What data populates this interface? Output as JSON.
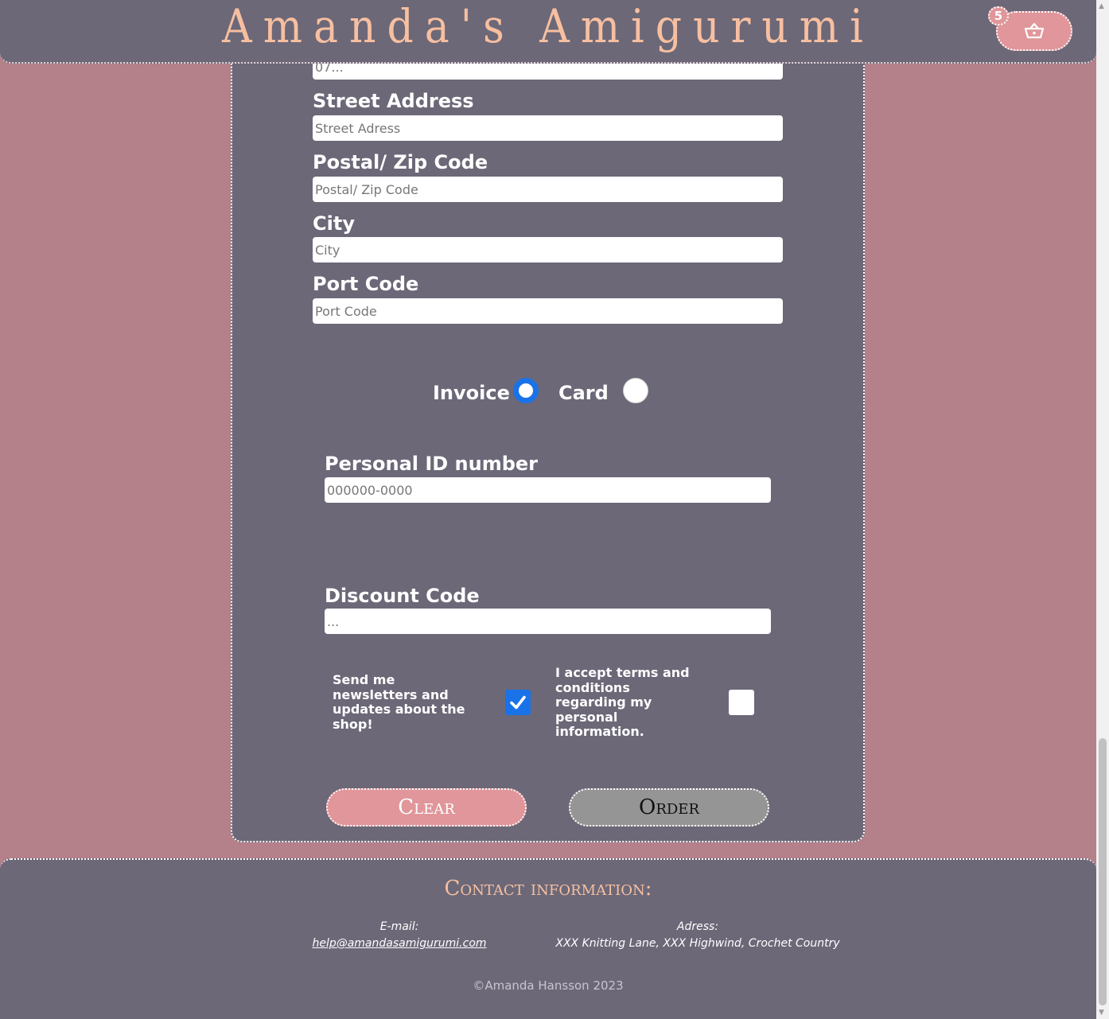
{
  "header": {
    "site_title": "Amanda's Amigurumi",
    "cart_count": "5",
    "cart_icon": "basket-icon"
  },
  "form": {
    "phone": {
      "placeholder": "07..."
    },
    "street": {
      "label": "Street Address",
      "placeholder": "Street Adress"
    },
    "postal": {
      "label": "Postal/ Zip Code",
      "placeholder": "Postal/ Zip Code"
    },
    "city": {
      "label": "City",
      "placeholder": "City"
    },
    "port": {
      "label": "Port Code",
      "placeholder": "Port Code"
    },
    "payment": {
      "invoice_label": "Invoice",
      "card_label": "Card",
      "selected": "Invoice"
    },
    "personal_id": {
      "label": "Personal ID number",
      "placeholder": "000000-0000"
    },
    "discount": {
      "label": "Discount Code",
      "placeholder": "..."
    },
    "newsletter": {
      "text": "Send me newsletters and updates about the shop!",
      "checked": true
    },
    "terms": {
      "text": "I accept terms and conditions regarding my personal information.",
      "checked": false
    },
    "clear_label": "Clear",
    "order_label": "Order"
  },
  "footer": {
    "contact_title": "Contact information:",
    "email_label": "E-mail:",
    "email": "help@amandasamigurumi.com",
    "address_label": "Adress:",
    "address": "XXX Knitting Lane, XXX Highwind, Crochet Country",
    "copyright": "©Amanda Hansson 2023"
  },
  "colors": {
    "page_bg": "#b4808a",
    "panel_bg": "#6c6878",
    "accent_pink": "#e0969a",
    "title_peach": "#f7bfa0",
    "radio_blue": "#1a72e8"
  }
}
